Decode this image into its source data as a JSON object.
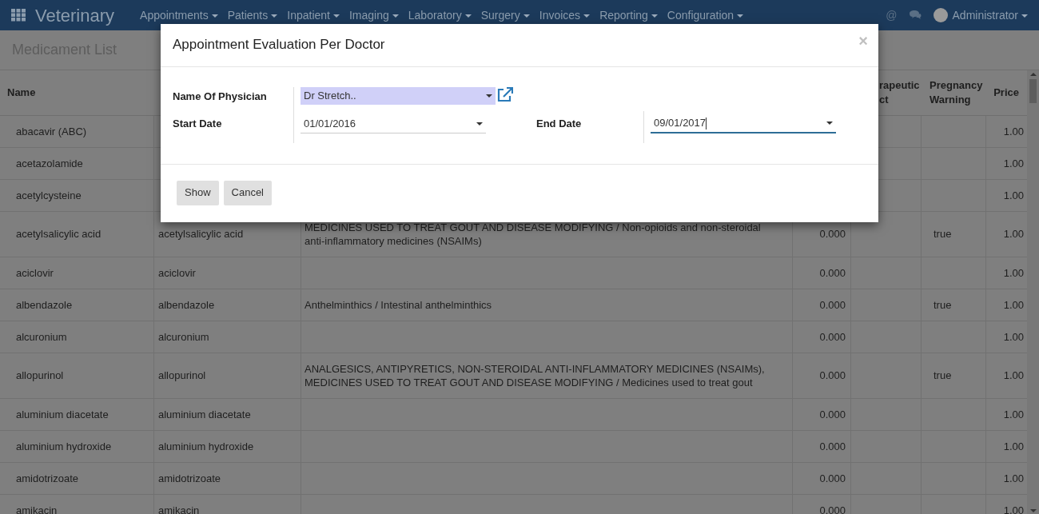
{
  "navbar": {
    "app_title": "Veterinary",
    "menus": [
      "Appointments",
      "Patients",
      "Inpatient",
      "Imaging",
      "Laboratory",
      "Surgery",
      "Invoices",
      "Reporting",
      "Configuration"
    ],
    "mention": "@",
    "user": "Administrator"
  },
  "page_title": "Medicament List",
  "table": {
    "columns": [
      "Name",
      "rapeutic ct",
      "Pregnancy Warning",
      "Price"
    ],
    "rows": [
      {
        "name": "abacavir (ABC)",
        "price": "1.00"
      },
      {
        "name": "acetazolamide",
        "price": "1.00"
      },
      {
        "name": "acetylcysteine",
        "price": "1.00"
      },
      {
        "name": "acetylsalicylic acid",
        "generic": "acetylsalicylic acid",
        "description": "MEDICINES USED TO TREAT GOUT AND DISEASE MODIFYING / Non-opioids and non-steroidal anti-inflammatory medicines (NSAIMs)",
        "quantity": "0.000",
        "pregnancy": "true",
        "price": "1.00"
      },
      {
        "name": "aciclovir",
        "generic": "aciclovir",
        "quantity": "0.000",
        "price": "1.00"
      },
      {
        "name": "albendazole",
        "generic": "albendazole",
        "description": "Anthelminthics / Intestinal anthelminthics",
        "quantity": "0.000",
        "pregnancy": "true",
        "price": "1.00"
      },
      {
        "name": "alcuronium",
        "generic": "alcuronium",
        "quantity": "0.000",
        "price": "1.00"
      },
      {
        "name": "allopurinol",
        "generic": "allopurinol",
        "description": "ANALGESICS, ANTIPYRETICS, NON-STEROIDAL ANTI-INFLAMMATORY MEDICINES (NSAIMs), MEDICINES USED TO TREAT GOUT AND DISEASE MODIFYING / Medicines used to treat gout",
        "quantity": "0.000",
        "pregnancy": "true",
        "price": "1.00"
      },
      {
        "name": "aluminium diacetate",
        "generic": "aluminium diacetate",
        "quantity": "0.000",
        "price": "1.00"
      },
      {
        "name": "aluminium hydroxide",
        "generic": "aluminium hydroxide",
        "quantity": "0.000",
        "price": "1.00"
      },
      {
        "name": "amidotrizoate",
        "generic": "amidotrizoate",
        "quantity": "0.000",
        "price": "1.00"
      },
      {
        "name": "amikacin",
        "generic": "amikacin",
        "quantity": "0.000",
        "price": "1.00"
      }
    ]
  },
  "dialog": {
    "title": "Appointment Evaluation Per Doctor",
    "close": "×",
    "physician": {
      "label": "Name Of Physician",
      "value": "Dr Stretch.."
    },
    "start_date": {
      "label": "Start Date",
      "value": "01/01/2016",
      "focused": false
    },
    "end_date": {
      "label": "End Date",
      "value": "09/01/2017",
      "focused": true
    },
    "buttons": [
      "Show",
      "Cancel"
    ]
  }
}
